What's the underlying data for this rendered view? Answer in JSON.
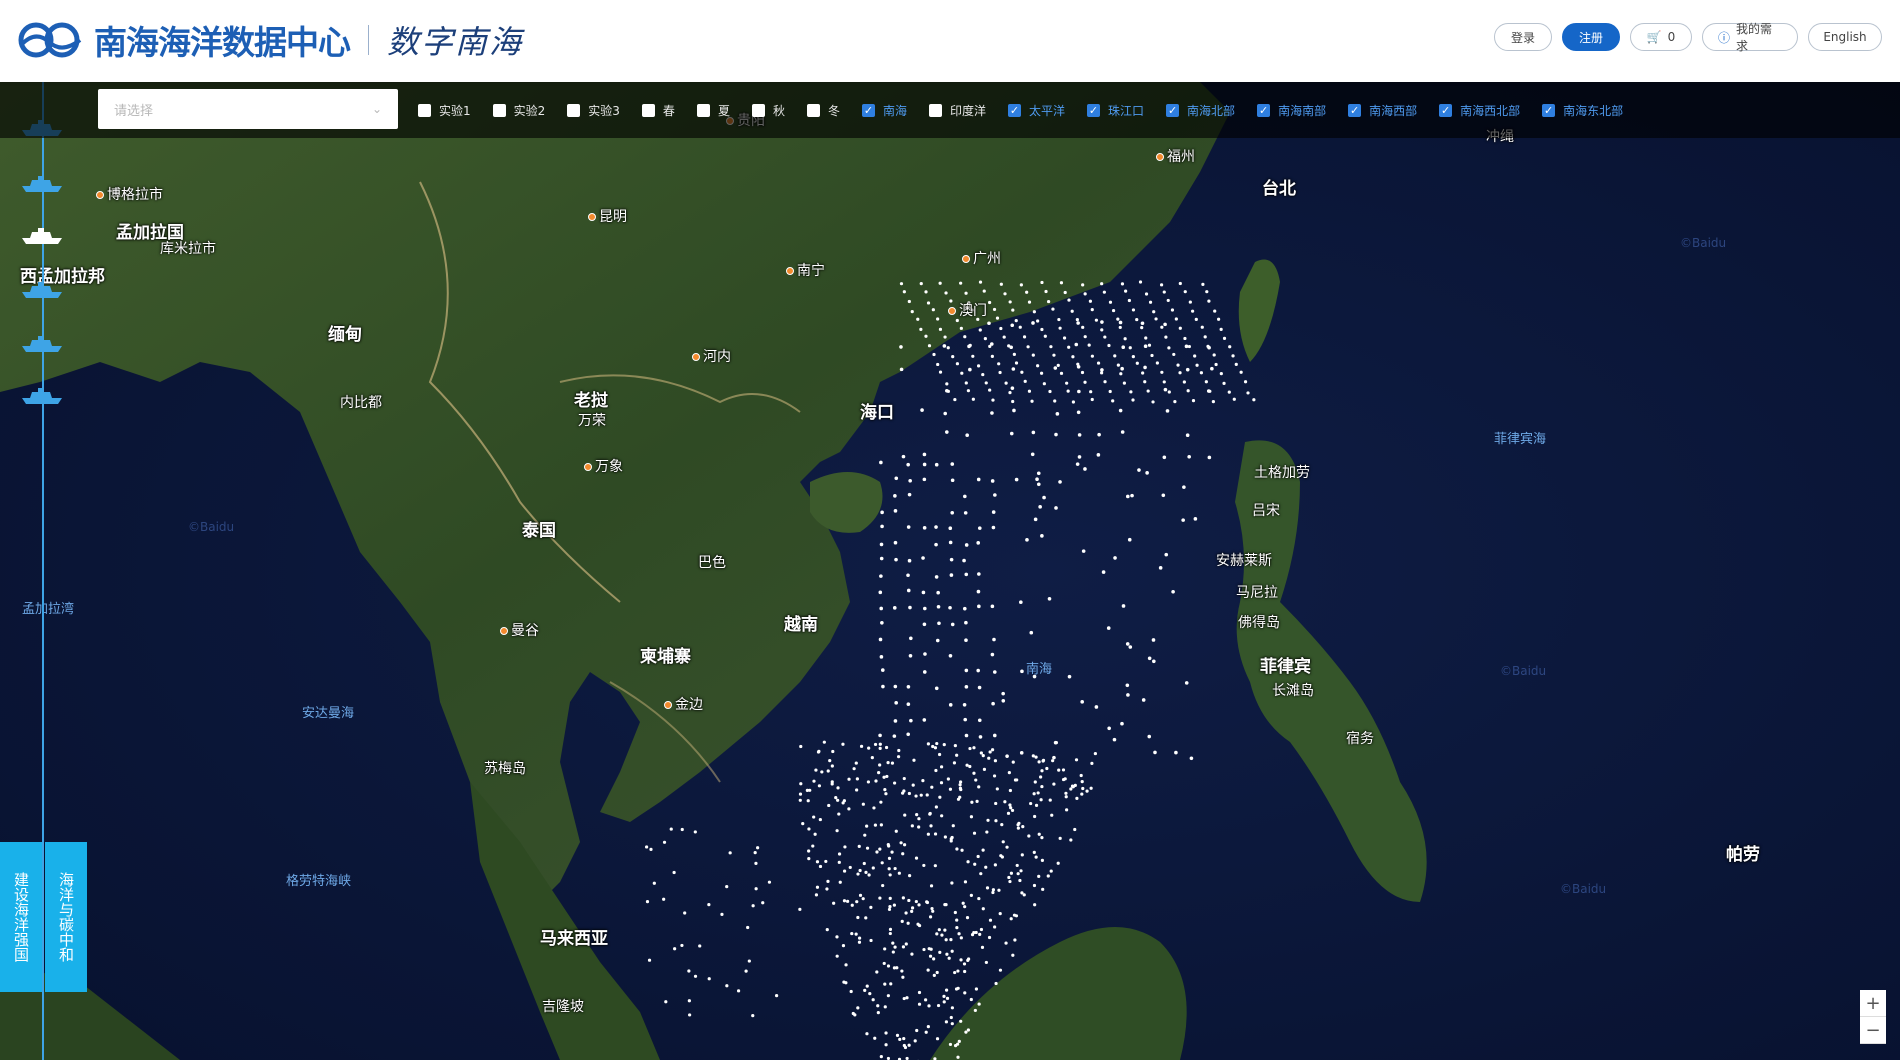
{
  "header": {
    "site_title": "南海海洋数据中心",
    "slogan": "数字南海",
    "buttons": {
      "login": "登录",
      "register": "注册",
      "cart_count": "0",
      "my_needs": "我的需求",
      "language": "English"
    }
  },
  "toolbar": {
    "select_placeholder": "请选择",
    "checkboxes": [
      {
        "label": "实验1",
        "checked": false
      },
      {
        "label": "实验2",
        "checked": false
      },
      {
        "label": "实验3",
        "checked": false
      },
      {
        "label": "春",
        "checked": false
      },
      {
        "label": "夏",
        "checked": false
      },
      {
        "label": "秋",
        "checked": false
      },
      {
        "label": "冬",
        "checked": false
      },
      {
        "label": "南海",
        "checked": true
      },
      {
        "label": "印度洋",
        "checked": false
      },
      {
        "label": "太平洋",
        "checked": true
      },
      {
        "label": "珠江口",
        "checked": true
      },
      {
        "label": "南海北部",
        "checked": true
      },
      {
        "label": "南海南部",
        "checked": true
      },
      {
        "label": "南海西部",
        "checked": true
      },
      {
        "label": "南海西北部",
        "checked": true
      },
      {
        "label": "南海东北部",
        "checked": true
      }
    ]
  },
  "side_tabs": {
    "tab1": "建设海洋强国",
    "tab2": "海洋与碳中和"
  },
  "map": {
    "labels": {
      "mengjialaguo": "孟加拉国",
      "xibengjialabang": "西孟加拉邦",
      "bogelaxi": "博格拉市",
      "kumila": "库米拉市",
      "miandian": "缅甸",
      "neibidu": "内比都",
      "kunming": "昆明",
      "guiyang": "贵阳",
      "nanning": "南宁",
      "guangzhou": "广州",
      "aomen": "澳门",
      "fuzhou": "福州",
      "taibei": "台北",
      "chongsheng": "冲绳",
      "henei": "河内",
      "haikou": "海口",
      "laowo": "老挝",
      "wanrong": "万荣",
      "wanxiang": "万象",
      "taiguo": "泰国",
      "base": "巴色",
      "yuenan": "越南",
      "mangu": "曼谷",
      "jianpuzhai": "柬埔寨",
      "jinbian": "金边",
      "nanhai": "南海",
      "sumeidao": "苏梅岛",
      "andamanhai": "安达曼海",
      "mengjialawan": "孟加拉湾",
      "gelaoguhaixia": "格劳特海峡",
      "malaixiya": "马来西亚",
      "jilongpo": "吉隆坡",
      "feilvbinhai": "菲律宾海",
      "tugejiala": "土格加劳",
      "lvsong": "吕宋",
      "anhelaisi": "安赫莱斯",
      "manila": "马尼拉",
      "fodesheng": "佛得岛",
      "feilvbin": "菲律宾",
      "changtandao": "长滩岛",
      "suwu": "宿务",
      "palao": "帕劳",
      "baidu": "©Baidu"
    }
  },
  "zoom": {
    "in": "+",
    "out": "−"
  },
  "colors": {
    "brand": "#1566c8",
    "accent_tab": "#19b1ea",
    "checked": "#2f7fe0",
    "ocean": "#0b1537",
    "land": "#2e4a22",
    "stations": "#ffffff"
  }
}
